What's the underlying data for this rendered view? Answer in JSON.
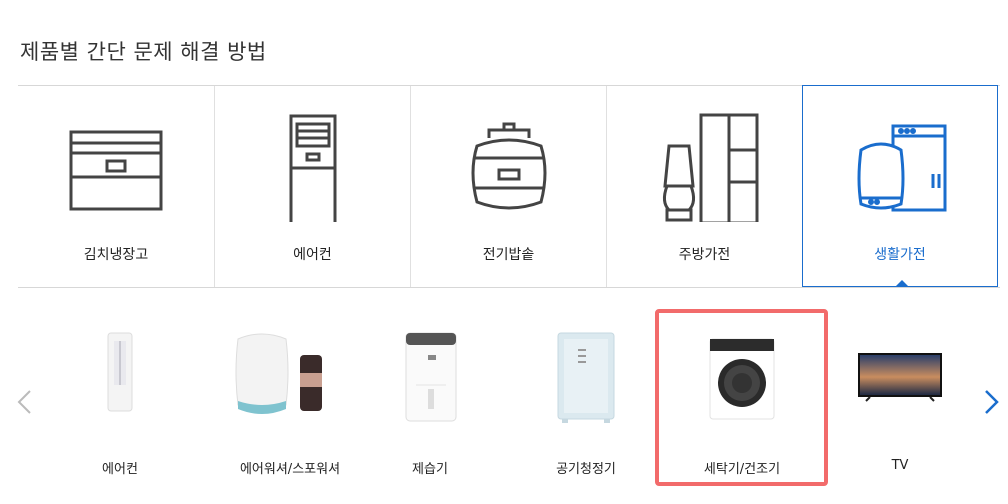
{
  "page_title": "제품별 간단 문제 해결 방법",
  "categories": [
    {
      "label": "김치냉장고",
      "icon": "kimchi-fridge-icon",
      "selected": false
    },
    {
      "label": "에어컨",
      "icon": "air-conditioner-icon",
      "selected": false
    },
    {
      "label": "전기밥솥",
      "icon": "rice-cooker-icon",
      "selected": false
    },
    {
      "label": "주방가전",
      "icon": "kitchen-appliance-icon",
      "selected": false
    },
    {
      "label": "생활가전",
      "icon": "home-appliance-icon",
      "selected": true
    }
  ],
  "subcategories": [
    {
      "label": "에어컨",
      "icon": "stand-air-conditioner-icon"
    },
    {
      "label": "에어워셔/스포워셔",
      "icon": "air-washer-icon"
    },
    {
      "label": "제습기",
      "icon": "dehumidifier-icon"
    },
    {
      "label": "공기청정기",
      "icon": "air-purifier-icon"
    },
    {
      "label": "세탁기/건조기",
      "icon": "washing-machine-icon",
      "highlighted": true
    },
    {
      "label": "TV",
      "icon": "tv-icon"
    }
  ],
  "colors": {
    "accent": "#1a6dcd",
    "highlight": "#f26b6b",
    "line_icon": "#444444"
  }
}
